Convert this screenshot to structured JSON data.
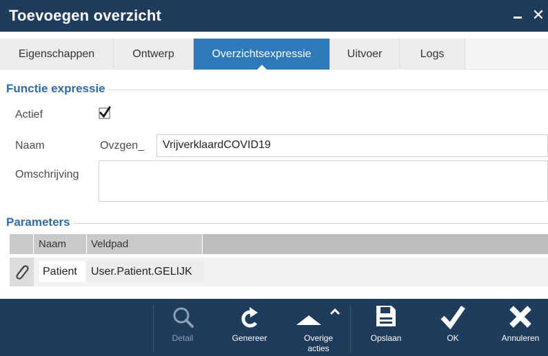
{
  "window": {
    "title": "Toevoegen overzicht",
    "minimize_icon": "minimize-icon",
    "close_icon": "close-icon"
  },
  "tabs": [
    {
      "label": "Eigenschappen",
      "active": false
    },
    {
      "label": "Ontwerp",
      "active": false
    },
    {
      "label": "Overzichtsexpressie",
      "active": true
    },
    {
      "label": "Uitvoer",
      "active": false
    },
    {
      "label": "Logs",
      "active": false
    }
  ],
  "function_expression": {
    "section_title": "Functie expressie",
    "actief_label": "Actief",
    "actief_checked": true,
    "naam_label": "Naam",
    "naam_prefix": "Ovzgen_",
    "naam_value": "VrijverklaardCOVID19",
    "omschrijving_label": "Omschrijving",
    "omschrijving_value": ""
  },
  "parameters": {
    "section_title": "Parameters",
    "columns": [
      "Naam",
      "Veldpad"
    ],
    "rows": [
      {
        "icon": "paperclip-icon",
        "naam": "Patient",
        "veldpad": "User.Patient.GELIJK"
      }
    ]
  },
  "toolbar": {
    "buttons": [
      {
        "label": "Detail",
        "icon": "search-icon",
        "enabled": false
      },
      {
        "label": "Genereer",
        "icon": "refresh-icon",
        "enabled": true
      },
      {
        "label": "Overige\nacties",
        "icon": "caret-up-icon",
        "enabled": true
      },
      {
        "label": "Opslaan",
        "icon": "save-icon",
        "enabled": true
      },
      {
        "label": "OK",
        "icon": "checkmark-icon",
        "enabled": true
      },
      {
        "label": "Annuleren",
        "icon": "close-icon",
        "enabled": true
      }
    ]
  },
  "colors": {
    "titlebar": "#1f3c5c",
    "tab_active": "#2e79b9",
    "section_title": "#2f6aa6",
    "toolbar": "#1f3c5c"
  }
}
